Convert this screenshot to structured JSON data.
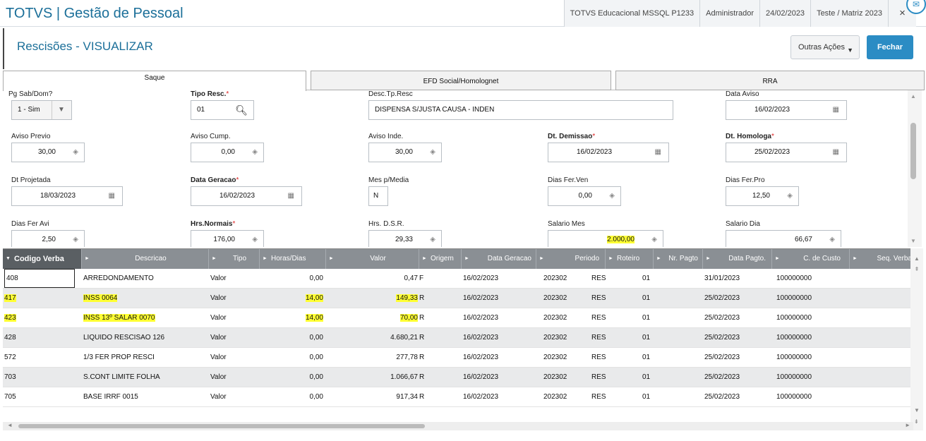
{
  "header": {
    "app_title": "TOTVS | Gestão de Pessoal",
    "server": "TOTVS Educacional MSSQL P1233",
    "user": "Administrador",
    "date": "24/02/2023",
    "branch": "Teste / Matriz 2023",
    "close_glyph": "×"
  },
  "page": {
    "title": "Rescisões - VISUALIZAR",
    "other_actions": "Outras Ações",
    "close_button": "Fechar"
  },
  "tabs": [
    "Saque",
    "EFD Social/Homolognet",
    "RRA"
  ],
  "fields": {
    "pg_sab_dom": {
      "label": "Pg Sab/Dom?",
      "value": "1 - Sim"
    },
    "tipo_resc": {
      "label": "Tipo Resc.",
      "value": "01"
    },
    "desc_tp_resc": {
      "label": "Desc.Tp.Resc",
      "value": "DISPENSA S/JUSTA CAUSA - INDEN"
    },
    "data_aviso": {
      "label": "Data Aviso",
      "value": "16/02/2023"
    },
    "aviso_previo": {
      "label": "Aviso Previo",
      "value": "30,00"
    },
    "aviso_cump": {
      "label": "Aviso Cump.",
      "value": "0,00"
    },
    "aviso_inde": {
      "label": "Aviso Inde.",
      "value": "30,00"
    },
    "dt_demissao": {
      "label": "Dt. Demissao",
      "value": "16/02/2023"
    },
    "dt_homologa": {
      "label": "Dt. Homologa",
      "value": "25/02/2023"
    },
    "dt_projetada": {
      "label": "Dt Projetada",
      "value": "18/03/2023"
    },
    "data_geracao": {
      "label": "Data Geracao",
      "value": "16/02/2023"
    },
    "mes_media": {
      "label": "Mes p/Media",
      "value": "N"
    },
    "dias_fer_ven": {
      "label": "Dias Fer.Ven",
      "value": "0,00"
    },
    "dias_fer_pro": {
      "label": "Dias Fer.Pro",
      "value": "12,50"
    },
    "dias_fer_avi": {
      "label": "Dias Fer Avi",
      "value": "2,50"
    },
    "hrs_normais": {
      "label": "Hrs.Normais",
      "value": "176,00"
    },
    "hrs_dsr": {
      "label": "Hrs. D.S.R.",
      "value": "29,33"
    },
    "salario_mes": {
      "label": "Salario Mes",
      "value": "2.000,00"
    },
    "salario_dia": {
      "label": "Salario Dia",
      "value": "66,67"
    }
  },
  "grid": {
    "columns": [
      "Codigo Verba",
      "Descricao",
      "Tipo",
      "Horas/Dias",
      "Valor",
      "Origem",
      "Data Geracao",
      "Periodo",
      "Roteiro",
      "Nr. Pagto",
      "Data Pagto.",
      "C. de Custo",
      "Seq. Verba"
    ],
    "rows": [
      {
        "codigo": "408",
        "descricao": "ARREDONDAMENTO",
        "tipo": "Valor",
        "horas": "0,00",
        "valor": "0,47",
        "origem": "F",
        "data_geracao": "16/02/2023",
        "periodo": "202302",
        "roteiro": "RES",
        "nr_pagto": "01",
        "data_pagto": "31/01/2023",
        "custo": "100000000"
      },
      {
        "codigo": "417",
        "descricao": "INSS 0064",
        "tipo": "Valor",
        "horas": "14,00",
        "valor": "149,33",
        "origem": "R",
        "data_geracao": "16/02/2023",
        "periodo": "202302",
        "roteiro": "RES",
        "nr_pagto": "01",
        "data_pagto": "25/02/2023",
        "custo": "100000000"
      },
      {
        "codigo": "423",
        "descricao": "INSS 13º SALAR 0070",
        "tipo": "Valor",
        "horas": "14,00",
        "valor": "70,00",
        "origem": "R",
        "data_geracao": "16/02/2023",
        "periodo": "202302",
        "roteiro": "RES",
        "nr_pagto": "01",
        "data_pagto": "25/02/2023",
        "custo": "100000000"
      },
      {
        "codigo": "428",
        "descricao": "LIQUIDO RESCISAO 126",
        "tipo": "Valor",
        "horas": "0,00",
        "valor": "4.680,21",
        "origem": "R",
        "data_geracao": "16/02/2023",
        "periodo": "202302",
        "roteiro": "RES",
        "nr_pagto": "01",
        "data_pagto": "25/02/2023",
        "custo": "100000000"
      },
      {
        "codigo": "572",
        "descricao": "1/3 FER PROP RESCI",
        "tipo": "Valor",
        "horas": "0,00",
        "valor": "277,78",
        "origem": "R",
        "data_geracao": "16/02/2023",
        "periodo": "202302",
        "roteiro": "RES",
        "nr_pagto": "01",
        "data_pagto": "25/02/2023",
        "custo": "100000000"
      },
      {
        "codigo": "703",
        "descricao": "S.CONT LIMITE FOLHA",
        "tipo": "Valor",
        "horas": "0,00",
        "valor": "1.066,67",
        "origem": "R",
        "data_geracao": "16/02/2023",
        "periodo": "202302",
        "roteiro": "RES",
        "nr_pagto": "01",
        "data_pagto": "25/02/2023",
        "custo": "100000000"
      },
      {
        "codigo": "705",
        "descricao": "BASE IRRF 0015",
        "tipo": "Valor",
        "horas": "0,00",
        "valor": "917,34",
        "origem": "R",
        "data_geracao": "16/02/2023",
        "periodo": "202302",
        "roteiro": "RES",
        "nr_pagto": "01",
        "data_pagto": "25/02/2023",
        "custo": "100000000"
      }
    ]
  },
  "colors": {
    "accent": "#2b8cc4",
    "title": "#1b6f99",
    "highlight": "#ffff33",
    "header_bg": "#8a8f94"
  }
}
